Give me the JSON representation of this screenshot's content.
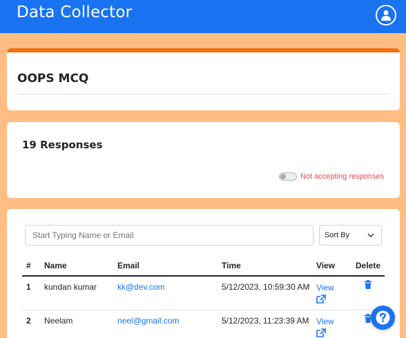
{
  "app": {
    "brand": "Data Collector"
  },
  "form": {
    "title": "OOPS MCQ"
  },
  "responses": {
    "count_label": "19 Responses",
    "accepting_toggle": {
      "on": false,
      "label": "Not accepting responses"
    }
  },
  "filters": {
    "search_placeholder": "Start Typing Name or Email",
    "sort_label": "Sort By"
  },
  "table": {
    "columns": [
      "#",
      "Name",
      "Email",
      "Time",
      "View",
      "Delete"
    ],
    "rows": [
      {
        "num": "1",
        "name": "kundan kumar",
        "email": "kk@dev.com",
        "time": "5/12/2023, 10:59:30 AM",
        "view": "View"
      },
      {
        "num": "2",
        "name": "Neelam",
        "email": "neel@gmail.com",
        "time": "5/12/2023, 11:23:39 AM",
        "view": "View"
      }
    ]
  },
  "icons": {
    "account": "user-circle-icon",
    "view": "external-link-icon",
    "delete": "trash-icon",
    "help": "question-circle-icon",
    "sort": "chevron-down-icon"
  },
  "colors": {
    "navbar": "#1a73f0",
    "background": "#ffbd83",
    "accent_bar": "#f27113",
    "link": "#1a73f0",
    "warning_text": "#e8474f"
  }
}
